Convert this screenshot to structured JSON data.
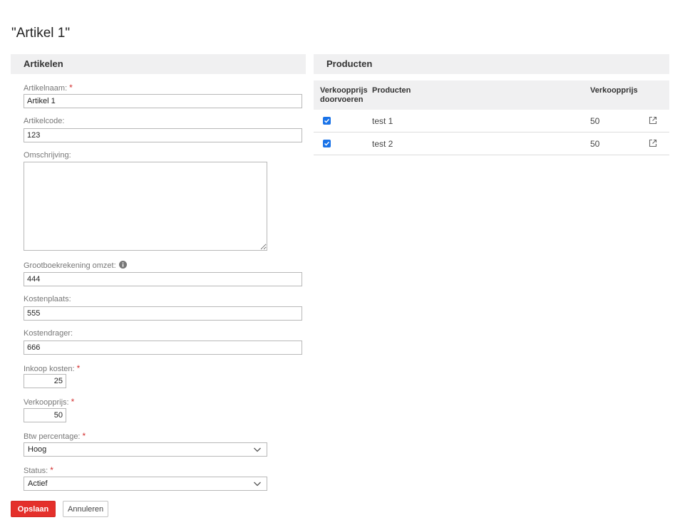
{
  "page": {
    "title": "\"Artikel 1\""
  },
  "left_panel": {
    "header": "Artikelen",
    "fields": {
      "artikelnaam": {
        "label": "Artikelnaam:",
        "value": "Artikel 1",
        "required": "*"
      },
      "artikelcode": {
        "label": "Artikelcode:",
        "value": "123"
      },
      "omschrijving": {
        "label": "Omschrijving:",
        "value": ""
      },
      "grootboekrekening": {
        "label": "Grootboekrekening omzet:",
        "value": "444"
      },
      "kostenplaats": {
        "label": "Kostenplaats:",
        "value": "555"
      },
      "kostendrager": {
        "label": "Kostendrager:",
        "value": "666"
      },
      "inkoop_kosten": {
        "label": "Inkoop kosten:",
        "value": "25",
        "required": "*"
      },
      "verkoopprijs": {
        "label": "Verkoopprijs:",
        "value": "50",
        "required": "*"
      },
      "btw_percentage": {
        "label": "Btw percentage:",
        "value": "Hoog",
        "required": "*"
      },
      "status": {
        "label": "Status:",
        "value": "Actief",
        "required": "*"
      }
    },
    "buttons": {
      "save": "Opslaan",
      "cancel": "Annuleren"
    }
  },
  "right_panel": {
    "header": "Producten",
    "columns": {
      "doorvoeren_line1": "Verkoopprijs",
      "doorvoeren_line2": "doorvoeren",
      "producten": "Producten",
      "verkoopprijs": "Verkoopprijs"
    },
    "rows": [
      {
        "checked": true,
        "product": "test 1",
        "price": "50"
      },
      {
        "checked": true,
        "product": "test 2",
        "price": "50"
      }
    ]
  },
  "colors": {
    "accent": "#1a73e8",
    "save_button": "#e4302b",
    "required": "#d32f2f",
    "header_bg": "#f0f0f1"
  },
  "icons": {
    "info": "info-circle-icon",
    "external": "external-link-icon",
    "dropdown": "chevron-down-icon",
    "check": "checkmark-icon"
  }
}
